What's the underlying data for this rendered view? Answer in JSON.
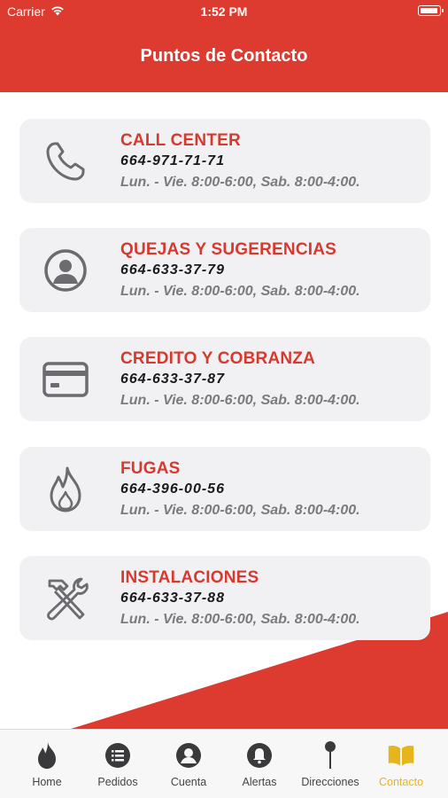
{
  "status_bar": {
    "carrier": "Carrier",
    "time": "1:52 PM"
  },
  "nav": {
    "title": "Puntos de Contacto"
  },
  "contacts": [
    {
      "title": "CALL CENTER",
      "phone": "664-971-71-71",
      "hours": "Lun. - Vie. 8:00-6:00, Sab. 8:00-4:00.",
      "icon": "phone-icon"
    },
    {
      "title": "QUEJAS Y SUGERENCIAS",
      "phone": "664-633-37-79",
      "hours": "Lun. - Vie. 8:00-6:00, Sab. 8:00-4:00.",
      "icon": "user-circle-icon"
    },
    {
      "title": "CREDITO Y COBRANZA",
      "phone": "664-633-37-87",
      "hours": "Lun. - Vie. 8:00-6:00, Sab. 8:00-4:00.",
      "icon": "credit-card-icon"
    },
    {
      "title": "FUGAS",
      "phone": "664-396-00-56",
      "hours": "Lun. - Vie. 8:00-6:00, Sab. 8:00-4:00.",
      "icon": "flame-icon"
    },
    {
      "title": "INSTALACIONES",
      "phone": "664-633-37-88",
      "hours": "Lun. - Vie. 8:00-6:00, Sab. 8:00-4:00.",
      "icon": "tools-icon"
    }
  ],
  "tabbar": {
    "tabs": [
      {
        "label": "Home",
        "icon": "flame-icon"
      },
      {
        "label": "Pedidos",
        "icon": "list-icon"
      },
      {
        "label": "Cuenta",
        "icon": "user-icon"
      },
      {
        "label": "Alertas",
        "icon": "bell-icon"
      },
      {
        "label": "Direcciones",
        "icon": "pin-icon"
      },
      {
        "label": "Contacto",
        "icon": "book-icon"
      }
    ],
    "active": "Contacto"
  },
  "colors": {
    "brand_red": "#dd3b30",
    "active_tab": "#e6b51e",
    "card_bg": "#f1f1f3",
    "icon_gray": "#6b6b70"
  }
}
